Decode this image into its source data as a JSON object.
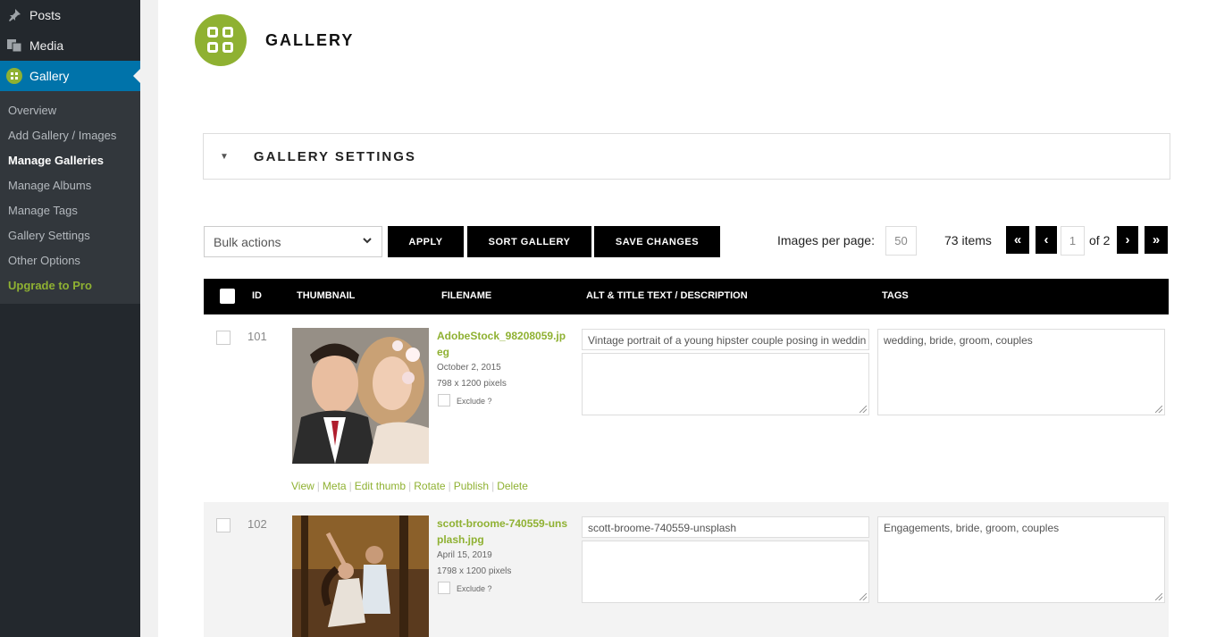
{
  "sidebar": {
    "top_items": [
      {
        "label": "Posts",
        "icon": "pushpin-icon"
      },
      {
        "label": "Media",
        "icon": "media-icon"
      },
      {
        "label": "Gallery",
        "icon": "gallery-icon",
        "active": true
      }
    ],
    "submenu": [
      {
        "label": "Overview"
      },
      {
        "label": "Add Gallery / Images"
      },
      {
        "label": "Manage Galleries",
        "current": true
      },
      {
        "label": "Manage Albums"
      },
      {
        "label": "Manage Tags"
      },
      {
        "label": "Gallery Settings"
      },
      {
        "label": "Other Options"
      },
      {
        "label": "Upgrade to Pro",
        "upgrade": true
      }
    ]
  },
  "header": {
    "title": "GALLERY"
  },
  "settings": {
    "label": "GALLERY SETTINGS"
  },
  "toolbar": {
    "bulk_actions": "Bulk actions",
    "apply": "APPLY",
    "sort": "SORT GALLERY",
    "save": "SAVE CHANGES",
    "images_per_page_label": "Images per page:",
    "images_per_page_value": "50",
    "items_count": "73 items",
    "first": "«",
    "prev": "‹",
    "page_value": "1",
    "of_pages": "of 2",
    "next": "›",
    "last": "»"
  },
  "table": {
    "headers": {
      "id": "ID",
      "thumbnail": "THUMBNAIL",
      "filename": "FILENAME",
      "alt": "ALT & TITLE TEXT / DESCRIPTION",
      "tags": "TAGS"
    },
    "rows": [
      {
        "id": "101",
        "filename": "AdobeStock_98208059.jpeg",
        "date": "October 2, 2015",
        "size": "798 x 1200 pixels",
        "exclude_label": "Exclude ?",
        "alt": "Vintage portrait of a young hipster couple posing  in weddin",
        "tags": "wedding, bride, groom, couples",
        "actions": [
          "View",
          "Meta",
          "Edit thumb",
          "Rotate",
          "Publish",
          "Delete"
        ]
      },
      {
        "id": "102",
        "filename": "scott-broome-740559-unsplash.jpg",
        "date": "April 15, 2019",
        "size": "1798 x 1200 pixels",
        "exclude_label": "Exclude ?",
        "alt": "scott-broome-740559-unsplash",
        "tags": "Engagements, bride, groom, couples"
      }
    ]
  },
  "colors": {
    "accent": "#8fb132",
    "sidebar": "#23282d",
    "active": "#0073aa"
  }
}
